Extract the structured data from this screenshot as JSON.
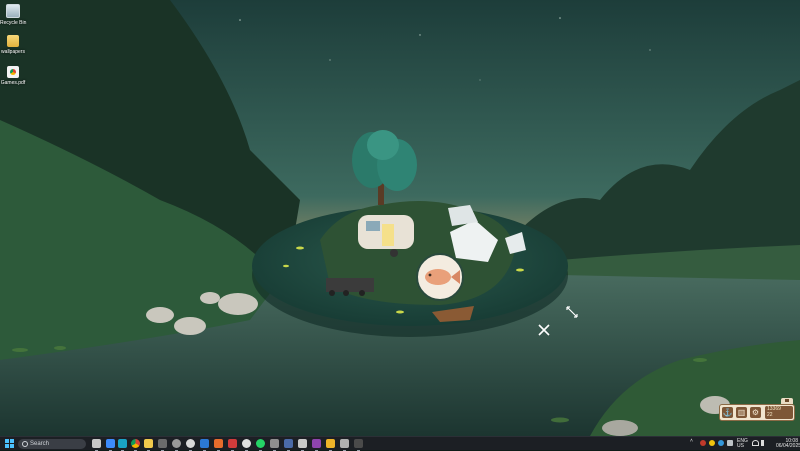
{
  "desktop": {
    "icons": [
      {
        "label": "Recycle Bin",
        "icon": "recycle-bin-icon"
      },
      {
        "label": "wallpapers",
        "icon": "folder-icon"
      },
      {
        "label": "Games.pdf",
        "icon": "pdf-document-icon"
      }
    ]
  },
  "game": {
    "widget_stats_line1": "13369",
    "widget_stats_line2": "22",
    "buttons": [
      "anchor-icon",
      "trash-icon",
      "gear-icon"
    ]
  },
  "taskbar": {
    "search_placeholder": "Search",
    "clock_time": "10:08",
    "clock_date": "06/04/2025",
    "language": "ENG",
    "language_sub": "US",
    "apps": [
      "file-explorer-icon",
      "edge-icon",
      "chrome-icon",
      "folder-icon",
      "store-icon",
      "settings-icon",
      "vscode-icon",
      "github-icon",
      "discord-icon",
      "whatsapp-icon",
      "steam-icon",
      "spotify-icon",
      "terminal-icon",
      "obsidian-icon",
      "notepad-icon",
      "game-icon",
      "terminal2-icon"
    ]
  },
  "colors": {
    "taskbar_bg": "#1c1f24",
    "accent": "#4cc2ff",
    "widget_bg": "#f1e5cf",
    "widget_brown": "#7d5636"
  }
}
